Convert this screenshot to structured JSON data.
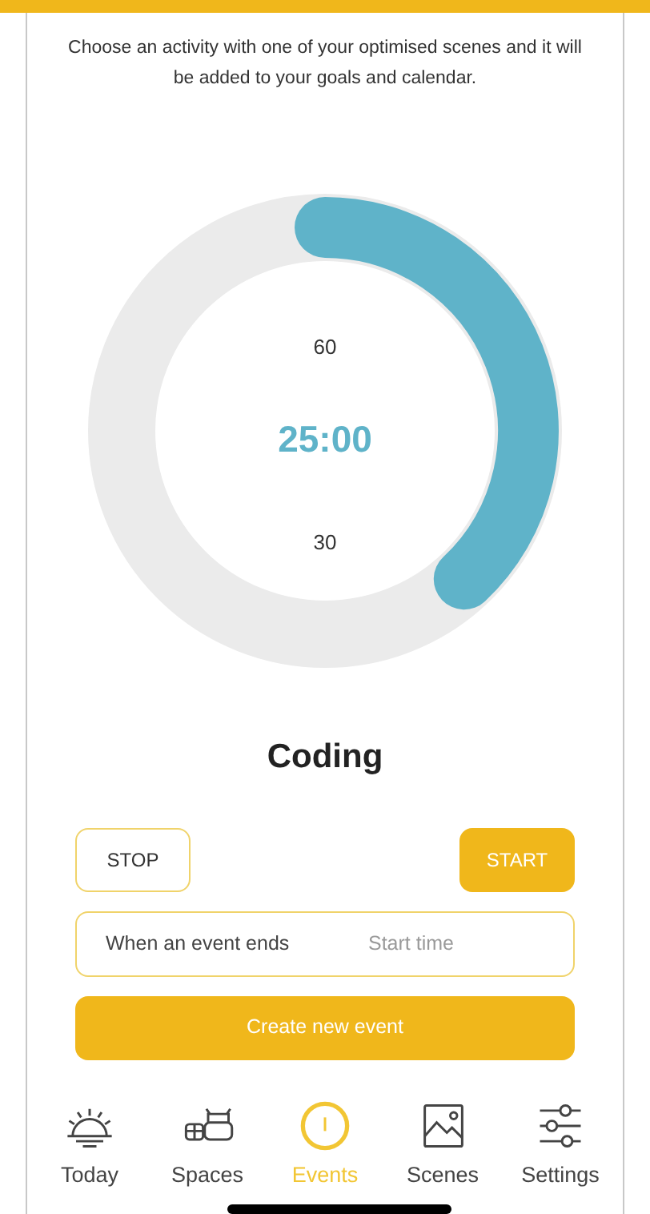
{
  "description": "Choose an activity with one of your optimised scenes and it will be added to your goals and calendar.",
  "timer": {
    "time": "25:00",
    "upper_label": "60",
    "lower_label": "30"
  },
  "activity": "Coding",
  "buttons": [
    {
      "label": "STOP",
      "kind": "outline"
    },
    {
      "label": "START",
      "kind": "filled"
    }
  ],
  "trigger_field": {
    "value": "When an event ends",
    "placeholder": "Start time"
  },
  "create_button": "Create new event",
  "nav": [
    {
      "label": "Today",
      "kind": "sunrise",
      "selected": false
    },
    {
      "label": "Spaces",
      "kind": "furniture",
      "selected": false
    },
    {
      "label": "Events",
      "kind": "clock",
      "selected": true
    },
    {
      "label": "Scenes",
      "kind": "image",
      "selected": false
    },
    {
      "label": "Settings",
      "kind": "sliders",
      "selected": false
    }
  ]
}
